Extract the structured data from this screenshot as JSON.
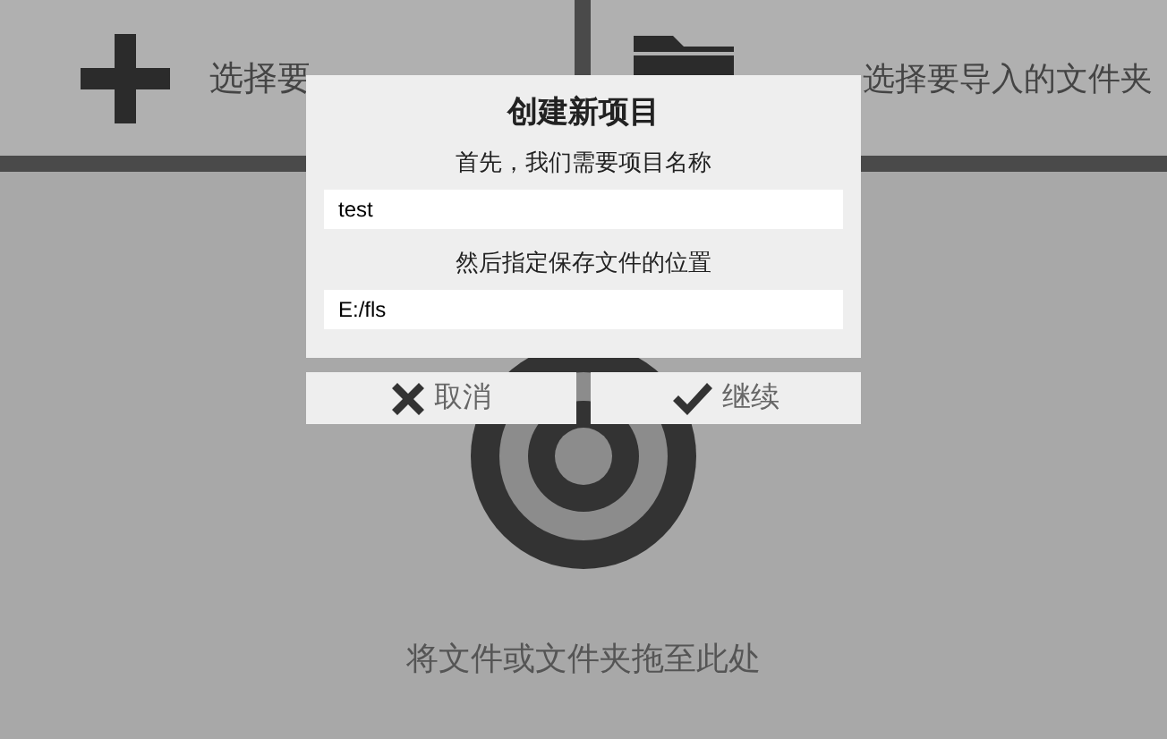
{
  "tiles": [
    {
      "kind": "file",
      "label": "选择要"
    },
    {
      "kind": "folder",
      "label": "选择要导入的文件夹"
    }
  ],
  "drop_zone": {
    "label": "将文件或文件夹拖至此处"
  },
  "dialog": {
    "title": "创建新项目",
    "fields": [
      {
        "label": "首先，我们需要项目名称",
        "value": "test"
      },
      {
        "label": "然后指定保存文件的位置",
        "value": "E:/fls"
      }
    ],
    "buttons": [
      {
        "kind": "cancel",
        "label": "取消"
      },
      {
        "kind": "confirm",
        "label": "继续"
      }
    ]
  }
}
